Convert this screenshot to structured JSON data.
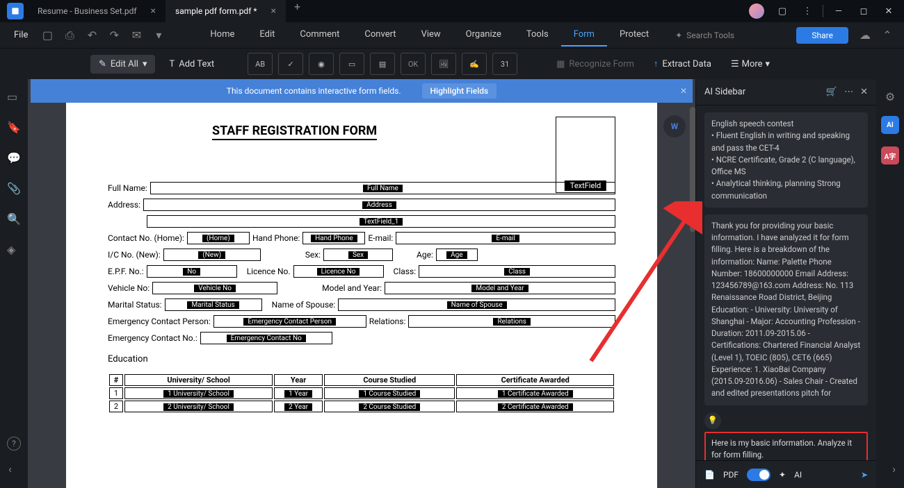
{
  "tabs": [
    {
      "title": "Resume - Business Set.pdf",
      "active": false
    },
    {
      "title": "sample pdf form.pdf *",
      "active": true
    }
  ],
  "menubar": {
    "file": "File",
    "items": [
      "Home",
      "Edit",
      "Comment",
      "Convert",
      "View",
      "Organize",
      "Tools",
      "Form",
      "Protect"
    ],
    "active": "Form",
    "search_placeholder": "Search Tools",
    "share": "Share"
  },
  "toolbar": {
    "edit_all": "Edit All",
    "add_text": "Add Text",
    "icons": [
      "AB",
      "✓",
      "◉",
      "▭",
      "▤",
      "OK",
      "img",
      "sig",
      "31"
    ],
    "recognize": "Recognize Form",
    "extract": "Extract Data",
    "more": "More"
  },
  "banner": {
    "text": "This document contains interactive form fields.",
    "button": "Highlight Fields"
  },
  "form": {
    "title": "STAFF REGISTRATION FORM",
    "text_field": "TextField",
    "labels": {
      "full_name": "Full Name:",
      "full_name_tag": "Full Name",
      "address": "Address:",
      "address_tag": "Address",
      "textfield1_tag": "TextField_1",
      "contact_home": "Contact No. (Home):",
      "home_tag": "(Home)",
      "hand_phone": "Hand Phone:",
      "hand_phone_tag": "Hand Phone",
      "email": "E-mail:",
      "email_tag": "E-mail",
      "ic_new": "I/C No. (New):",
      "new_tag": "(New)",
      "sex": "Sex:",
      "sex_tag": "Sex",
      "age": "Age:",
      "age_tag": "Age",
      "epf": "E.P.F. No.:",
      "no_tag": "No",
      "licence": "Licence No.",
      "licence_tag": "Licence No",
      "class": "Class:",
      "class_tag": "Class",
      "vehicle": "Vehicle No:",
      "vehicle_tag": "Vehicle No",
      "model": "Model and Year:",
      "model_tag": "Model and Year",
      "marital": "Marital Status:",
      "marital_tag": "Marital Status",
      "spouse": "Name of Spouse:",
      "spouse_tag": "Name of Spouse",
      "emerg_person": "Emergency Contact Person:",
      "emerg_person_tag": "Emergency Contact Person",
      "relations": "Relations:",
      "relations_tag": "Relations",
      "emerg_no": "Emergency Contact No.:",
      "emerg_no_tag": "Emergency Contact No",
      "education": "Education"
    },
    "edu_headers": [
      "#",
      "University/ School",
      "Year",
      "Course Studied",
      "Certificate Awarded"
    ],
    "edu_rows": [
      {
        "n": "1",
        "school": "1 University/ School",
        "year": "1 Year",
        "course": "1 Course Studied",
        "cert": "1 Certificate Awarded"
      },
      {
        "n": "2",
        "school": "2 University/ School",
        "year": "2 Year",
        "course": "2 Course Studied",
        "cert": "2 Certificate Awarded"
      }
    ]
  },
  "sidebar": {
    "title": "AI Sidebar",
    "msg1_lines": [
      "English speech contest",
      "• Fluent English in writing and speaking and pass the CET-4",
      "• NCRE Certificate, Grade 2 (C language), Office MS",
      "• Analytical thinking, planning Strong communication"
    ],
    "msg2": "Thank you for providing your basic information. I have analyzed it for form filling. Here is a breakdown of the information: Name: Palette Phone Number: 18600000000 Email Address: 123456789@163.com Address: No. 113 Renaissance Road District, Beijing Education: - University: University of Shanghai - Major: Accounting Profession - Duration: 2011.09-2015.06 - Certifications: Chartered Financial Analyst (Level 1), TOEIC (805), CET6 (665) Experience: 1. XiaoBai Company (2015.09-2016.06) - Sales Chair - Created and edited presentations pitch for",
    "user_msg": "Here is my basic information. Analyze it for form filling.",
    "footer": {
      "pdf": "PDF",
      "ai": "AI"
    }
  }
}
